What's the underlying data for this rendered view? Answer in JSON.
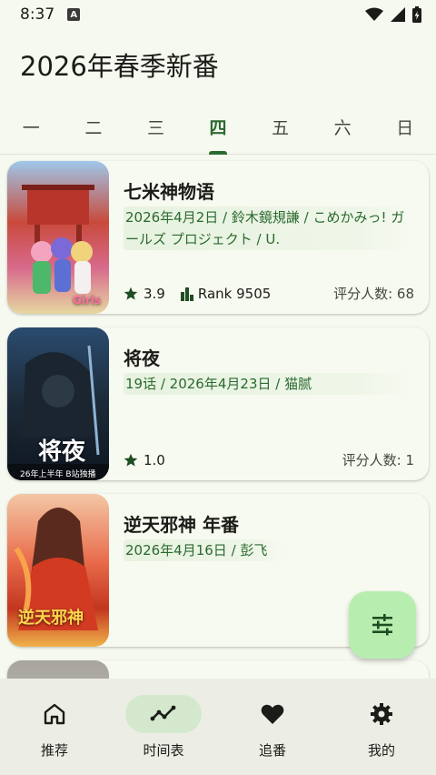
{
  "status_bar": {
    "time": "8:37",
    "a_icon": "A"
  },
  "header": {
    "title": "2026年春季新番"
  },
  "weekdays": [
    "一",
    "二",
    "三",
    "四",
    "五",
    "六",
    "日"
  ],
  "active_weekday": "四",
  "anime": [
    {
      "title": "七米神物语",
      "meta": "2026年4月2日 / 鈴木鏡規謙 / こめかみっ! ガールズ プロジェクト / U.",
      "rating": "3.9",
      "rank": "Rank 9505",
      "raters": "评分人数: 68",
      "cover_text": "Girls"
    },
    {
      "title": "将夜",
      "meta": "19话 / 2026年4月23日 / 猫腻",
      "rating": "1.0",
      "raters": "评分人数: 1",
      "cover_text": "将夜",
      "cover_subtext": "26年上半年 B站独播"
    },
    {
      "title": "逆天邪神 年番",
      "meta": "2026年4月16日 / 彭飞",
      "cover_text": "逆天邪神"
    }
  ],
  "nav": [
    {
      "label": "推荐",
      "icon": "home-icon"
    },
    {
      "label": "时间表",
      "icon": "trend-icon"
    },
    {
      "label": "追番",
      "icon": "heart-icon"
    },
    {
      "label": "我的",
      "icon": "settings-icon"
    }
  ],
  "colors": {
    "accent": "#2b6a2f",
    "fab_bg": "#b7eeb0",
    "nav_active_bg": "#d4e8cd"
  }
}
